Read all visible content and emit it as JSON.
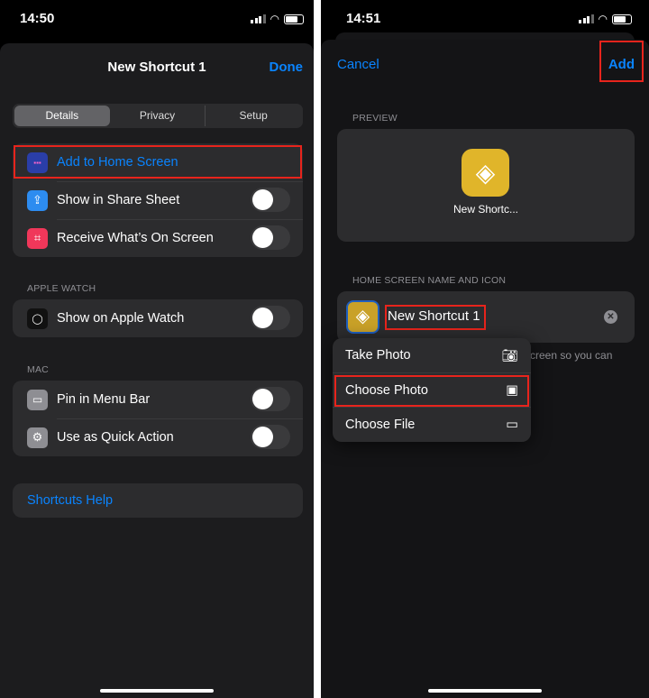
{
  "left": {
    "status": {
      "time": "14:50"
    },
    "title": "New Shortcut 1",
    "done": "Done",
    "tabs": [
      {
        "label": "Details",
        "selected": true
      },
      {
        "label": "Privacy"
      },
      {
        "label": "Setup"
      }
    ],
    "rows": [
      {
        "label": "Add to Home Screen",
        "icon": "home-screen-grid-icon",
        "highlighted": true
      },
      {
        "label": "Show in Share Sheet",
        "icon": "share-icon",
        "toggle": false
      },
      {
        "label": "Receive What’s On Screen",
        "icon": "screen-scan-icon",
        "toggle": false
      }
    ],
    "apple_watch": {
      "header": "APPLE WATCH",
      "rows": [
        {
          "label": "Show on Apple Watch",
          "icon": "apple-watch-icon",
          "toggle": false
        }
      ]
    },
    "mac": {
      "header": "MAC",
      "rows": [
        {
          "label": "Pin in Menu Bar",
          "icon": "menu-bar-icon",
          "toggle": false
        },
        {
          "label": "Use as Quick Action",
          "icon": "gear-icon",
          "toggle": false
        }
      ]
    },
    "help": "Shortcuts Help"
  },
  "right": {
    "status": {
      "time": "14:51"
    },
    "cancel": "Cancel",
    "add": "Add",
    "preview_header": "PREVIEW",
    "preview_name": "New Shortc...",
    "name_header": "HOME SCREEN NAME AND ICON",
    "name_value": "New Shortcut 1",
    "hint_fragment": "creen so you can",
    "menu": [
      {
        "label": "Take Photo",
        "icon": "camera-icon"
      },
      {
        "label": "Choose Photo",
        "icon": "photo-library-icon",
        "highlighted": true
      },
      {
        "label": "Choose File",
        "icon": "folder-icon"
      }
    ]
  },
  "colors": {
    "accent": "#0a84ff",
    "highlight": "#e8241c",
    "shortcut_icon": "#e0b52a"
  }
}
